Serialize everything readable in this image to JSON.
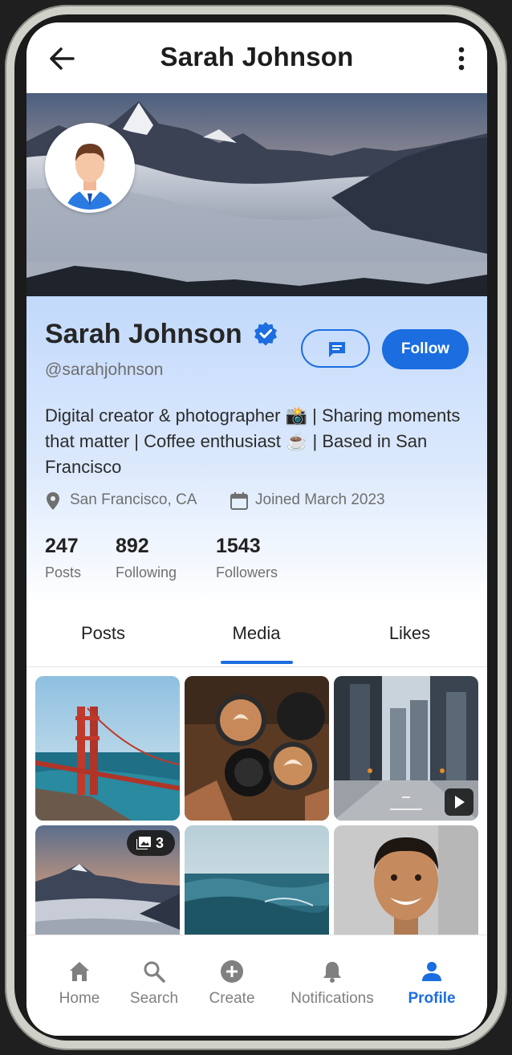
{
  "header": {
    "title": "Sarah Johnson",
    "back_icon": "arrow-left-icon",
    "more_icon": "more-vertical-icon"
  },
  "profile": {
    "name": "Sarah Johnson",
    "verified": true,
    "handle": "@sarahjohnson",
    "message_icon": "message-icon",
    "follow_label": "Follow",
    "bio": "Digital creator & photographer 📸 | Sharing moments that matter | Coffee enthusiast ☕ | Based in San Francisco",
    "location": "San Francisco, CA",
    "joined": "Joined March 2023",
    "stats": [
      {
        "value": "247",
        "label": "Posts"
      },
      {
        "value": "892",
        "label": "Following"
      },
      {
        "value": "1543",
        "label": "Followers"
      }
    ]
  },
  "tabs": [
    {
      "label": "Posts",
      "active": false
    },
    {
      "label": "Media",
      "active": true
    },
    {
      "label": "Likes",
      "active": false
    }
  ],
  "media": [
    {
      "subject": "golden-gate-bridge",
      "badge": ""
    },
    {
      "subject": "coffee-cups",
      "badge": ""
    },
    {
      "subject": "city-street",
      "badge": "video"
    },
    {
      "subject": "mountain-clouds",
      "badge": "3"
    },
    {
      "subject": "ocean-wave",
      "badge": ""
    },
    {
      "subject": "smiling-man-portrait",
      "badge": ""
    }
  ],
  "nav": [
    {
      "label": "Home",
      "icon": "home-icon",
      "active": false
    },
    {
      "label": "Search",
      "icon": "search-icon",
      "active": false
    },
    {
      "label": "Create",
      "icon": "add-circle-icon",
      "active": false
    },
    {
      "label": "Notifications",
      "icon": "bell-icon",
      "active": false
    },
    {
      "label": "Profile",
      "icon": "person-icon",
      "active": true
    }
  ],
  "colors": {
    "accent": "#1b6de0",
    "header_gradient_top": "#c2d9fb",
    "text": "#222222",
    "muted": "#707070"
  }
}
